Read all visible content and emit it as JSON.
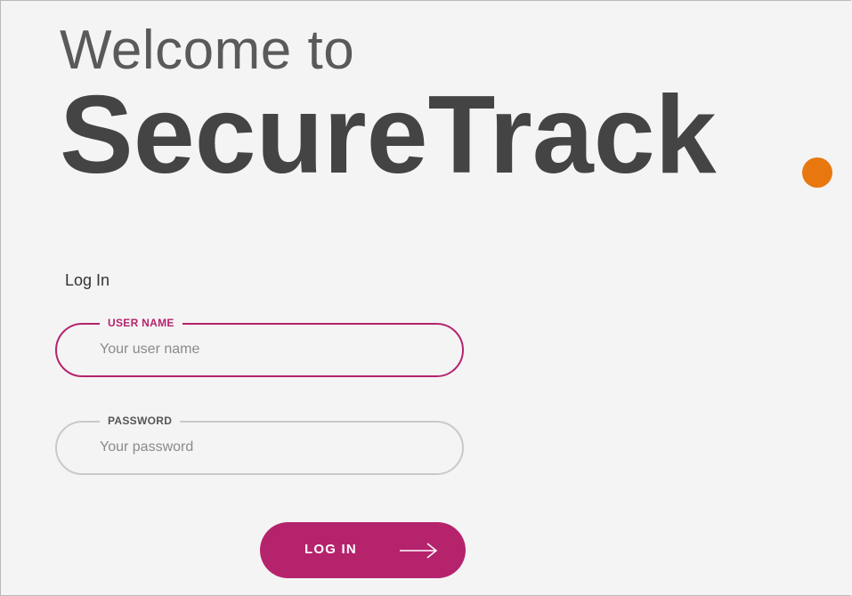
{
  "hero": {
    "welcome_text": "Welcome to",
    "brand_name": "SecureTrack",
    "brand_dot_icon": "dot-icon",
    "brand_dot_color": "#e8770f"
  },
  "login": {
    "title": "Log In",
    "username": {
      "label": "USER NAME",
      "placeholder": "Your user name",
      "value": ""
    },
    "password": {
      "label": "PASSWORD",
      "placeholder": "Your password",
      "value": ""
    },
    "submit": {
      "label": "LOG IN",
      "icon": "arrow-right-icon"
    }
  },
  "colors": {
    "accent": "#b5236d",
    "background": "#f4f4f4",
    "text_dark": "#444444",
    "inactive_border": "#c9c9c9"
  }
}
